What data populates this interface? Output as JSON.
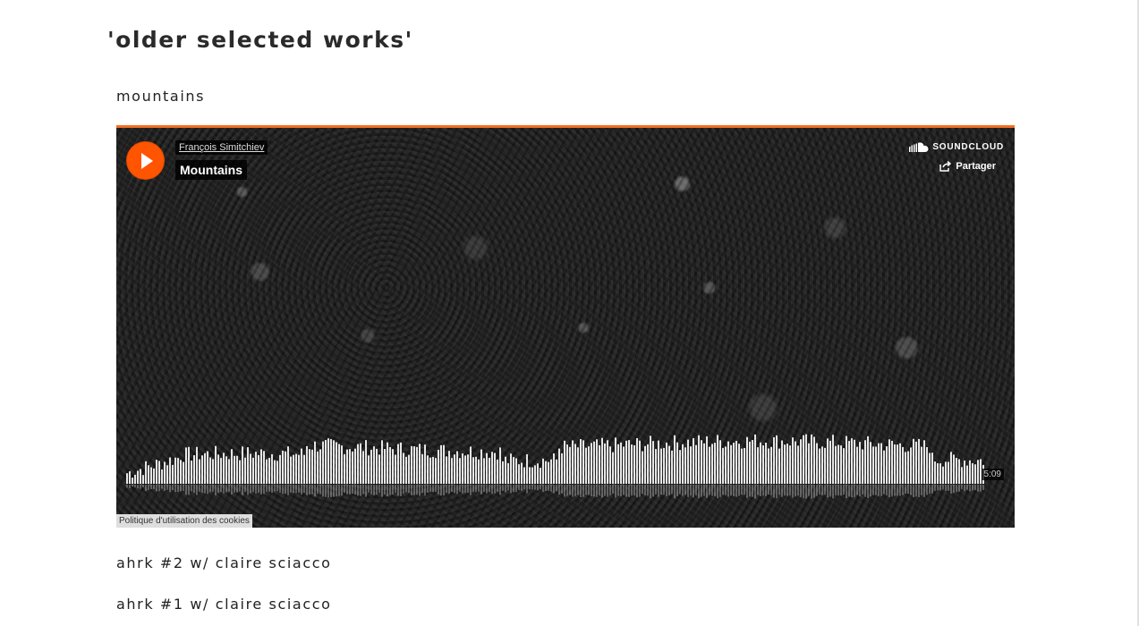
{
  "page": {
    "heading": "'older selected works'",
    "works": [
      "mountains",
      "ahrk #2 w/ claire sciacco",
      "ahrk #1 w/ claire sciacco"
    ]
  },
  "player": {
    "artist": "François Simitchiev",
    "track": "Mountains",
    "brand": "SOUNDCLOUD",
    "share_label": "Partager",
    "duration": "5:09",
    "cookie_label": "Politique d'utilisation des cookies",
    "accent_color": "#f26f23",
    "icons": [
      "play-icon",
      "soundcloud-icon",
      "share-icon"
    ]
  }
}
